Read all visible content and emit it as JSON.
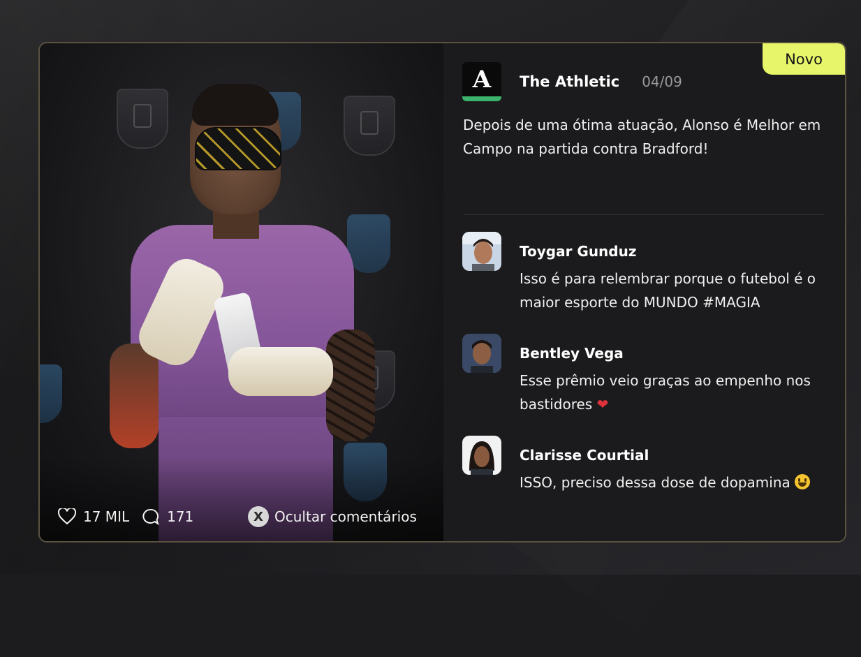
{
  "post": {
    "badge": "Novo",
    "author": "The Athletic",
    "date": "04/09",
    "text": "Depois de uma ótima atuação, Alonso é Melhor em Campo na partida contra Bradford!",
    "likes": "17 MIL",
    "comments_count": "171",
    "hide_comments_key": "X",
    "hide_comments_label": "Ocultar comentários",
    "logo_letter": "A"
  },
  "comments": [
    {
      "name": "Toygar Gunduz",
      "text": "Isso é para relembrar porque o futebol é o maior esporte do MUNDO #MAGIA",
      "emoji": ""
    },
    {
      "name": "Bentley Vega",
      "text": "Esse prêmio veio graças ao empenho nos bastidores",
      "emoji": "heart"
    },
    {
      "name": "Clarisse Courtial",
      "text": "ISSO, preciso dessa dose de dopamina",
      "emoji": "smile"
    }
  ],
  "colors": {
    "badge_bg": "#e6f56a",
    "card_border": "#5b5240",
    "logo_accent": "#3bb36c",
    "jersey": "#9a66a8"
  },
  "icons": {
    "like": "heart-outline-icon",
    "comment": "speech-bubble-icon",
    "hide": "x-button-icon",
    "emoji_1": "red-heart-emoji",
    "emoji_2": "grinning-face-emoji"
  }
}
